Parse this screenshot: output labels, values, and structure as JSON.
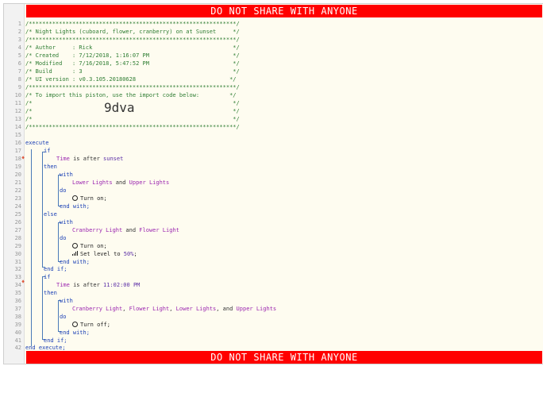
{
  "banner": {
    "top": "DO NOT SHARE WITH ANYONE",
    "bottom": "DO NOT SHARE WITH ANYONE"
  },
  "line_numbers": [
    "1",
    "2",
    "3",
    "4",
    "5",
    "6",
    "7",
    "8",
    "9",
    "10",
    "11",
    "12",
    "13",
    "14",
    "15",
    "16",
    "17",
    "18",
    "19",
    "20",
    "21",
    "22",
    "23",
    "24",
    "25",
    "26",
    "27",
    "28",
    "29",
    "30",
    "31",
    "32",
    "33",
    "34",
    "35",
    "36",
    "37",
    "38",
    "39",
    "40",
    "41",
    "42"
  ],
  "header": {
    "stars": "/**************************************************************/",
    "title": "/* Night Lights (cuboard, flower, cranberry) on at Sunset     */",
    "author": "/* Author     : Rick                                          */",
    "created": "/* Created    : 7/12/2018, 1:16:07 PM                         */",
    "modified": "/* Modified   : 7/16/2018, 5:47:52 PM                         */",
    "build": "/* Build      : 3                                             */",
    "ui_version": "/* UI version : v0.3.105.20180628                            */",
    "import_line": "/* To import this piston, use the import code below:         */",
    "blank": "/*                                                            */",
    "import_code": "9dva"
  },
  "code": {
    "execute": "execute",
    "end_execute": "end execute;",
    "if": "if",
    "then": "then",
    "else": "else",
    "end_if": "end if;",
    "with": "with",
    "do": "do",
    "end_with": "end with;",
    "time": "Time",
    "is_after": " is after ",
    "sunset": "sunset",
    "time_11": "11:02:00 PM",
    "lower_lights": "Lower Lights",
    "upper_lights": "Upper Lights",
    "cranberry_light": "Cranberry Light",
    "flower_light": "Flower Light",
    "and": " and ",
    "comma": ", ",
    "comma_and": ", and ",
    "turn_on": "Turn on;",
    "turn_off": "Turn off;",
    "set_level_prefix": "Set level to ",
    "set_level_value": "50%",
    "semicolon": ";"
  }
}
